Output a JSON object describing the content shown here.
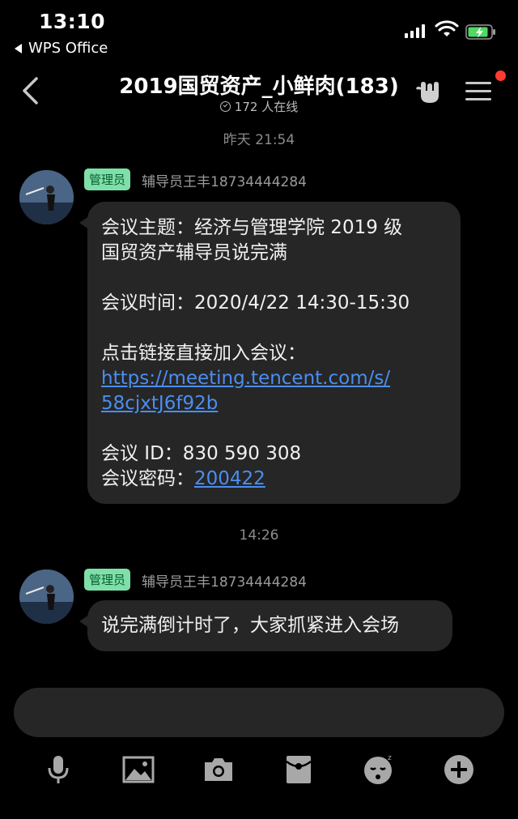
{
  "status_bar": {
    "time": "13:10",
    "back_app": "WPS Office"
  },
  "header": {
    "title": "2019国贸资产_小鲜肉(183)",
    "online": "172 人在线"
  },
  "messages": [
    {
      "timestamp": "昨天 21:54",
      "badge": "管理员",
      "sender": "辅导员王丰18734444284",
      "lines": {
        "l1": "会议主题：经济与管理学院 2019 级",
        "l2": "国贸资产辅导员说完满",
        "l3": "会议时间：2020/4/22 14:30-15:30",
        "l4": "点击链接直接加入会议：",
        "link1": "https://meeting.tencent.com/s/",
        "link2": "58cjxtJ6f92b",
        "l5": "会议 ID：830 590 308",
        "l6_prefix": "会议密码：",
        "password": "200422"
      }
    },
    {
      "timestamp": "14:26",
      "badge": "管理员",
      "sender": "辅导员王丰18734444284",
      "text": "说完满倒计时了，大家抓紧进入会场"
    }
  ],
  "toolbar": {
    "icons": [
      "microphone-icon",
      "image-icon",
      "camera-icon",
      "red-packet-icon",
      "emoji-icon",
      "plus-icon"
    ]
  },
  "colors": {
    "background": "#000000",
    "bubble": "#262626",
    "badge": "#7ee0a8",
    "link": "#4a8ef0",
    "notification_dot": "#ff3b30"
  }
}
